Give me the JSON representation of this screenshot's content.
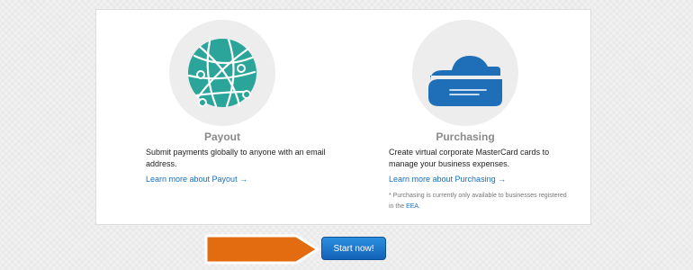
{
  "payout": {
    "icon": "globe-network-icon",
    "title": "Payout",
    "description": "Submit payments globally to anyone with an email address.",
    "link": "Learn more about Payout →"
  },
  "purchasing": {
    "icon": "cloud-card-icon",
    "title": "Purchasing",
    "description": "Create virtual corporate MasterCard cards to manage your business expenses.",
    "link": "Learn more about Purchasing →",
    "note_prefix": "* Purchasing is currently only available to businesses registered in the ",
    "note_link": "EEA",
    "note_suffix": "."
  },
  "cta": {
    "label": "Start now!",
    "arrow_icon": "orange-arrow-icon"
  },
  "colors": {
    "globe": "#2ba59a",
    "cloud": "#1f6fb8",
    "link": "#1a6fbd",
    "arrow": "#e36b10",
    "button": "#1a6fc6"
  }
}
